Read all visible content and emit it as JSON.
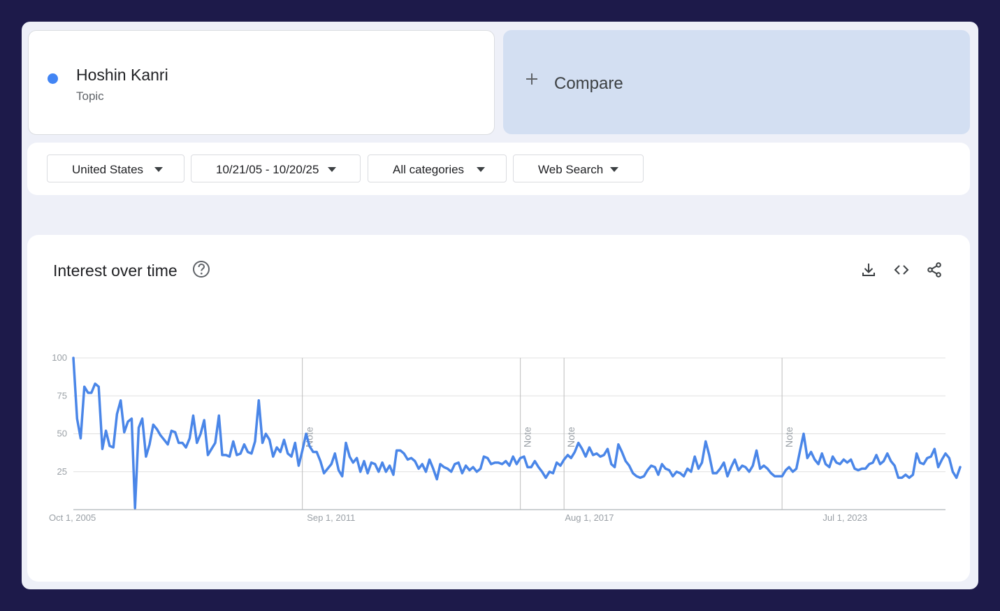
{
  "term": {
    "name": "Hoshin Kanri",
    "type": "Topic",
    "color": "#4285f4"
  },
  "compare": {
    "label": "Compare",
    "icon": "plus-icon"
  },
  "filters": {
    "region": "United States",
    "date_range": "10/21/05 - 10/20/25",
    "category": "All categories",
    "property": "Web Search"
  },
  "chart_section": {
    "title": "Interest over time",
    "help_icon": "help-icon",
    "actions": [
      "download-icon",
      "embed-icon",
      "share-icon"
    ]
  },
  "chart_data": {
    "type": "line",
    "title": "Interest over time",
    "xlabel": "",
    "ylabel": "",
    "ylim": [
      0,
      100
    ],
    "yticks": [
      25,
      50,
      75,
      100
    ],
    "grid": true,
    "legend": "none",
    "x_start": "2005-10-01",
    "x_end": "2025-10-01",
    "x_ticks": [
      {
        "label": "Oct 1, 2005",
        "date": "2005-10-01"
      },
      {
        "label": "Sep 1, 2011",
        "date": "2011-09-01"
      },
      {
        "label": "Aug 1, 2017",
        "date": "2017-08-01"
      },
      {
        "label": "Jul 1, 2023",
        "date": "2023-07-01"
      }
    ],
    "notes": [
      {
        "label": "Note",
        "date": "2011-01-01"
      },
      {
        "label": "Note",
        "date": "2016-01-01"
      },
      {
        "label": "Note",
        "date": "2017-01-01"
      },
      {
        "label": "Note",
        "date": "2022-01-01"
      }
    ],
    "series": [
      {
        "color": "#4a86e8",
        "frequency": "monthly",
        "start": "2005-10-01",
        "values": [
          100,
          60,
          47,
          81,
          77,
          77,
          83,
          81,
          40,
          52,
          42,
          41,
          63,
          72,
          51,
          58,
          60,
          1,
          54,
          60,
          35,
          43,
          56,
          53,
          49,
          46,
          43,
          52,
          51,
          44,
          44,
          41,
          47,
          62,
          44,
          50,
          59,
          36,
          40,
          44,
          62,
          36,
          36,
          35,
          45,
          36,
          37,
          43,
          38,
          37,
          45,
          72,
          44,
          50,
          46,
          35,
          41,
          38,
          46,
          37,
          35,
          44,
          29,
          39,
          50,
          42,
          38,
          38,
          32,
          24,
          27,
          30,
          37,
          26,
          22,
          44,
          35,
          31,
          34,
          25,
          32,
          24,
          31,
          30,
          25,
          31,
          25,
          29,
          23,
          39,
          39,
          37,
          33,
          34,
          32,
          27,
          30,
          25,
          33,
          27,
          20,
          30,
          28,
          27,
          25,
          30,
          31,
          24,
          29,
          26,
          28,
          25,
          27,
          35,
          34,
          30,
          31,
          31,
          30,
          32,
          29,
          35,
          30,
          34,
          35,
          28,
          28,
          32,
          28,
          25,
          21,
          25,
          24,
          31,
          29,
          33,
          36,
          34,
          38,
          44,
          40,
          35,
          41,
          36,
          37,
          35,
          36,
          40,
          30,
          28,
          43,
          38,
          32,
          29,
          24,
          22,
          21,
          22,
          26,
          29,
          28,
          23,
          30,
          27,
          26,
          22,
          25,
          24,
          22,
          27,
          25,
          35,
          27,
          31,
          45,
          36,
          24,
          24,
          27,
          31,
          22,
          28,
          33,
          26,
          29,
          28,
          25,
          29,
          39,
          27,
          29,
          27,
          24,
          22,
          22,
          22,
          26,
          28,
          25,
          27,
          39,
          50,
          34,
          38,
          33,
          30,
          37,
          30,
          28,
          35,
          31,
          30,
          33,
          31,
          33,
          27,
          26,
          27,
          27,
          30,
          31,
          36,
          30,
          32,
          37,
          32,
          29,
          21,
          21,
          23,
          21,
          23,
          37,
          31,
          30,
          34,
          35,
          40,
          28,
          33,
          37,
          34,
          25,
          21,
          28
        ]
      }
    ]
  }
}
